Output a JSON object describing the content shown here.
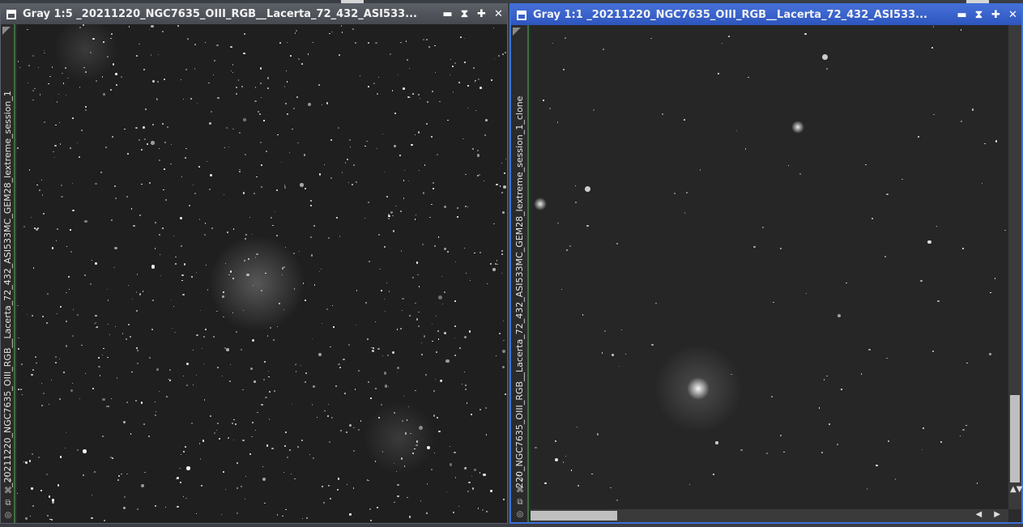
{
  "windows": [
    {
      "title": "Gray 1:5 _20211220_NGC7635_OIII_RGB__Lacerta_72_432_ASI533...",
      "side_label": "_20211220_NGC7635_OIII_RGB__Lacerta_72_432_ASI533MC_GEM28_lextreme_session_1",
      "active": false
    },
    {
      "title": "Gray 1:1 _20211220_NGC7635_OIII_RGB__Lacerta_72_432_ASI533...",
      "side_label": "220_NGC7635_OIII_RGB__Lacerta_72_432_ASI533MC_GEM28_lextreme_session_1_clone",
      "active": true
    }
  ],
  "title_buttons": {
    "shade": "▬",
    "collapse": "⧗",
    "maximize": "✚",
    "close": "✕"
  },
  "side_icons": [
    "pin-icon",
    "mask-icon",
    "zoom-icon",
    "stf-icon"
  ],
  "side_glyphs": [
    "⤡",
    "⌘",
    "⧉",
    "◎"
  ],
  "scroll": {
    "vertical_position": 0.82,
    "horizontal_position": 0.0,
    "arrows_v": "▲▼",
    "arrows_h": "◀ ▶"
  },
  "colors": {
    "active_title": "#3d6fd9",
    "inactive_title": "#50545b",
    "frame_accent": "#3e6e3e"
  }
}
